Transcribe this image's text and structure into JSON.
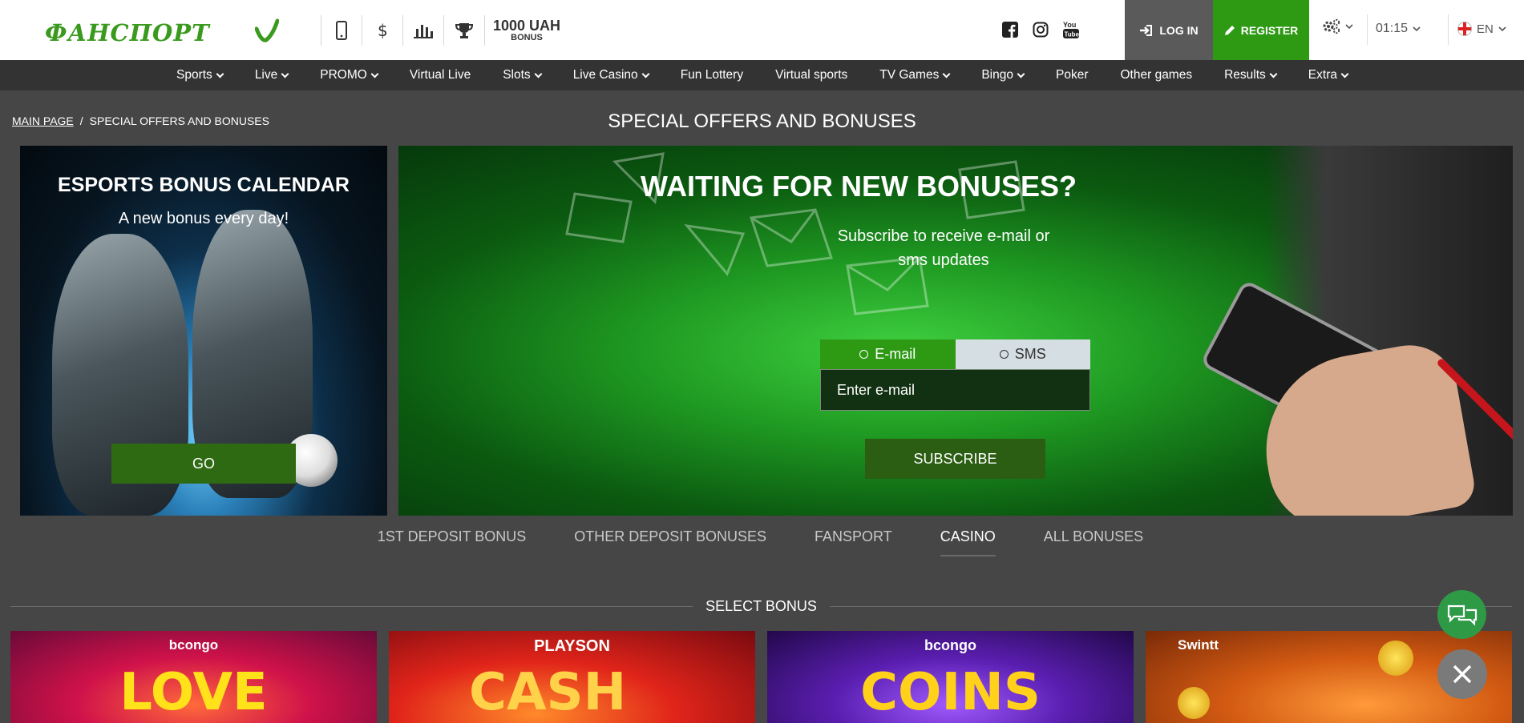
{
  "header": {
    "logo_text": "ФАНСПОРТ",
    "bonus_amount": "1000 UAH",
    "bonus_label": "BONUS",
    "login_label": "LOG IN",
    "register_label": "REGISTER",
    "time": "01:15",
    "language": "EN",
    "icons": [
      "mobile-icon",
      "dollar-icon",
      "stats-icon",
      "trophy-icon"
    ],
    "social_icons": [
      "facebook-icon",
      "instagram-icon",
      "youtube-icon"
    ]
  },
  "nav": {
    "items": [
      {
        "label": "Sports",
        "dropdown": true
      },
      {
        "label": "Live",
        "dropdown": true
      },
      {
        "label": "PROMO",
        "dropdown": true
      },
      {
        "label": "Virtual Live",
        "dropdown": false
      },
      {
        "label": "Slots",
        "dropdown": true
      },
      {
        "label": "Live Casino",
        "dropdown": true
      },
      {
        "label": "Fun Lottery",
        "dropdown": false
      },
      {
        "label": "Virtual sports",
        "dropdown": false
      },
      {
        "label": "TV Games",
        "dropdown": true
      },
      {
        "label": "Bingo",
        "dropdown": true
      },
      {
        "label": "Poker",
        "dropdown": false
      },
      {
        "label": "Other games",
        "dropdown": false
      },
      {
        "label": "Results",
        "dropdown": true
      },
      {
        "label": "Extra",
        "dropdown": true
      }
    ]
  },
  "breadcrumb": {
    "home": "MAIN PAGE",
    "separator": "/",
    "current": "SPECIAL OFFERS AND BONUSES"
  },
  "page_title": "SPECIAL OFFERS AND BONUSES",
  "esports": {
    "title": "ESPORTS BONUS CALENDAR",
    "subtitle": "A new bonus every day!",
    "button": "GO"
  },
  "subscribe": {
    "title": "WAITING FOR NEW BONUSES?",
    "subtitle": "Subscribe to receive e-mail or sms updates",
    "options": [
      "E-mail",
      "SMS"
    ],
    "selected": "E-mail",
    "input_placeholder": "Enter e-mail",
    "button": "SUBSCRIBE"
  },
  "tabs": [
    {
      "label": "1ST DEPOSIT BONUS",
      "active": false
    },
    {
      "label": "OTHER DEPOSIT BONUSES",
      "active": false
    },
    {
      "label": "FANSPORT",
      "active": false
    },
    {
      "label": "CASINO",
      "active": true
    },
    {
      "label": "ALL BONUSES",
      "active": false
    }
  ],
  "select_bonus_label": "SELECT BONUS",
  "tiles": [
    {
      "brand": "bcongo",
      "name": "LOVE"
    },
    {
      "brand": "PLAYSON",
      "name": "CASH"
    },
    {
      "brand": "bcongo",
      "name": "COINS"
    },
    {
      "brand": "Swintt",
      "name": ""
    }
  ],
  "colors": {
    "brand_green": "#2e9a14",
    "nav_bg": "#333333",
    "page_bg": "#464646"
  }
}
